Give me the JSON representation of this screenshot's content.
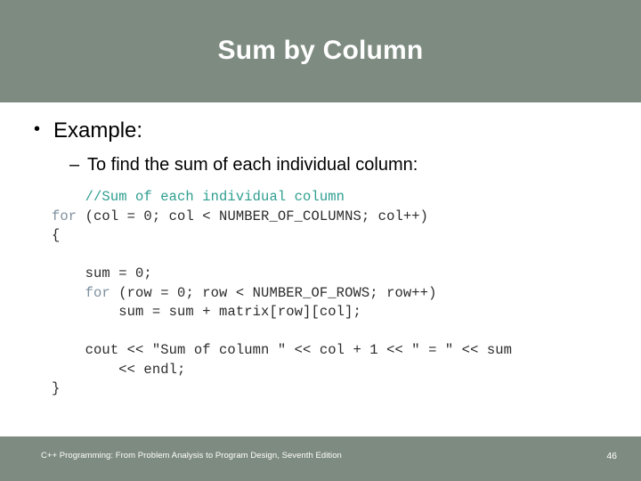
{
  "slide": {
    "title": "Sum by Column",
    "theme": {
      "band_color": "#7e8b80",
      "band_text_color": "#ffffff",
      "body_background": "#ffffff",
      "body_text_color": "#000000",
      "code_comment_color": "#2e9e8f",
      "code_keyword_color": "#7f909f",
      "code_text_color": "#2b2b2b"
    },
    "bullets": {
      "level1_marker": "•",
      "level1_text": "Example:",
      "level2_marker": "–",
      "level2_text": "To find the sum of each individual column:"
    },
    "code": {
      "language": "cpp",
      "lines": [
        {
          "indent": "    ",
          "segments": [
            {
              "kind": "comment",
              "text": "//Sum of each individual column"
            }
          ]
        },
        {
          "indent": "",
          "segments": [
            {
              "kind": "keyword",
              "text": "for"
            },
            {
              "kind": "plain",
              "text": " (col = 0; col < NUMBER_OF_COLUMNS; col++)"
            }
          ]
        },
        {
          "indent": "",
          "segments": [
            {
              "kind": "plain",
              "text": "{"
            }
          ]
        },
        {
          "indent": "",
          "segments": []
        },
        {
          "indent": "    ",
          "segments": [
            {
              "kind": "plain",
              "text": "sum = 0;"
            }
          ]
        },
        {
          "indent": "    ",
          "segments": [
            {
              "kind": "keyword",
              "text": "for"
            },
            {
              "kind": "plain",
              "text": " (row = 0; row < NUMBER_OF_ROWS; row++)"
            }
          ]
        },
        {
          "indent": "        ",
          "segments": [
            {
              "kind": "plain",
              "text": "sum = sum + matrix[row][col];"
            }
          ]
        },
        {
          "indent": "",
          "segments": []
        },
        {
          "indent": "    ",
          "segments": [
            {
              "kind": "plain",
              "text": "cout << \"Sum of column \" << col + 1 << \" = \" << sum"
            }
          ]
        },
        {
          "indent": "        ",
          "segments": [
            {
              "kind": "plain",
              "text": "<< endl;"
            }
          ]
        },
        {
          "indent": "",
          "segments": [
            {
              "kind": "plain",
              "text": "}"
            }
          ]
        }
      ]
    },
    "footer": {
      "citation": "C++ Programming: From Problem Analysis to Program Design, Seventh Edition",
      "page_number": "46"
    }
  }
}
